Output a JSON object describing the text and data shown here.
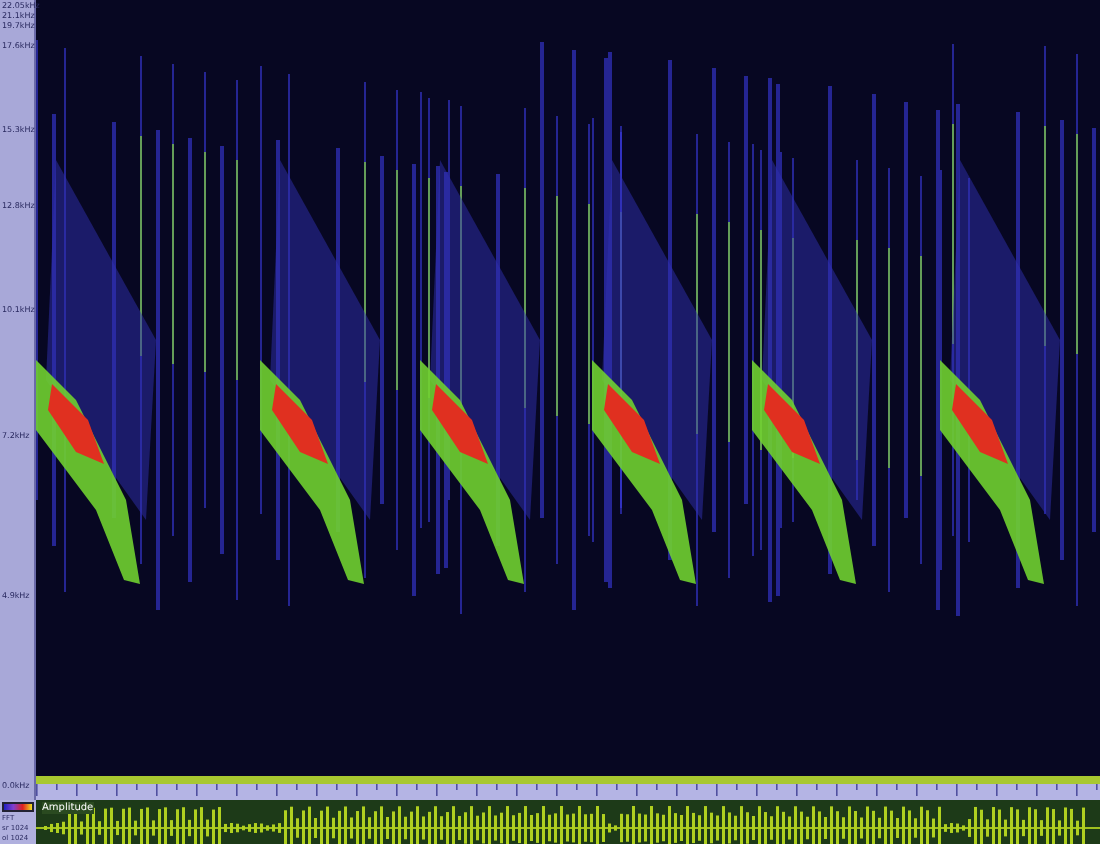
{
  "frequency_axis": {
    "labels": [
      "22.05kHz",
      "21.1kHz",
      "19.7kHz",
      "17.6kHz",
      "15.3kHz",
      "12.8kHz",
      "10.1kHz",
      "7.2kHz",
      "4.9kHz",
      "0.0kHz"
    ]
  },
  "waveform": {
    "label": "Amplitude"
  },
  "fft_info": {
    "lines": [
      "FFT",
      "sr 1024",
      "ol 1024"
    ]
  }
}
